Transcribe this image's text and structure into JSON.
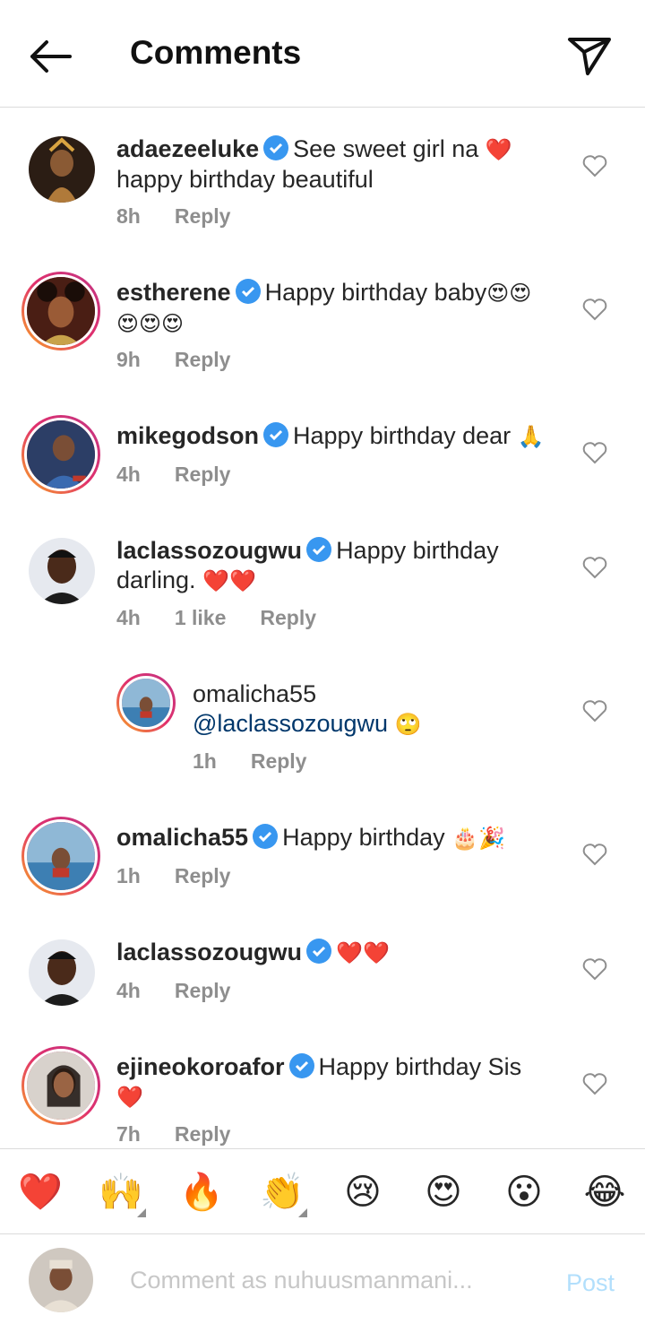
{
  "header": {
    "title": "Comments",
    "back_icon": "arrow-left-icon",
    "share_icon": "paper-plane-icon"
  },
  "colors": {
    "verified": "#3897f0",
    "heart_red": "#ed1c24",
    "link": "#00376b",
    "post_disabled": "#b2dffc",
    "ring": "#e1306c"
  },
  "comments": [
    {
      "username": "adaezeeluke",
      "text_line1": "See sweet girl na",
      "emoji1": "❤️",
      "text_line2": "happy birthday  beautiful",
      "time": "8h",
      "reply": "Reply"
    },
    {
      "username": "estherene",
      "text_line1": "Happy birthday baby",
      "emoji1": "😍😍",
      "emoji2": "😍😍😍",
      "time": "9h",
      "reply": "Reply"
    },
    {
      "username": "mikegodson",
      "text_line1": "Happy birthday dear",
      "emoji1": "🙏",
      "time": "4h",
      "reply": "Reply"
    },
    {
      "username": "laclassozougwu",
      "text_line1": "Happy birthday",
      "text_line2": "darling.",
      "emoji2": "❤️❤️",
      "time": "4h",
      "likes": "1 like",
      "reply": "Reply"
    },
    {
      "username": "omalicha55",
      "mention": "@laclassozougwu",
      "emoji1": "🙄",
      "time": "1h",
      "reply": "Reply"
    },
    {
      "username": "omalicha55",
      "text_line1": "Happy birthday",
      "emoji1": "🎂🎉",
      "time": "1h",
      "reply": "Reply"
    },
    {
      "username": "laclassozougwu",
      "emoji1": "❤️❤️",
      "time": "4h",
      "reply": "Reply"
    },
    {
      "username": "ejineokoroafor",
      "text_line1": "Happy birthday Sis",
      "emoji2": "❤️",
      "time": "7h",
      "reply": "Reply"
    }
  ],
  "reactions": [
    "❤️",
    "🙌",
    "🔥",
    "👏",
    "😢",
    "😍",
    "😮",
    "😂"
  ],
  "composer": {
    "placeholder": "Comment as nuhuusmanmani...",
    "post_label": "Post"
  }
}
